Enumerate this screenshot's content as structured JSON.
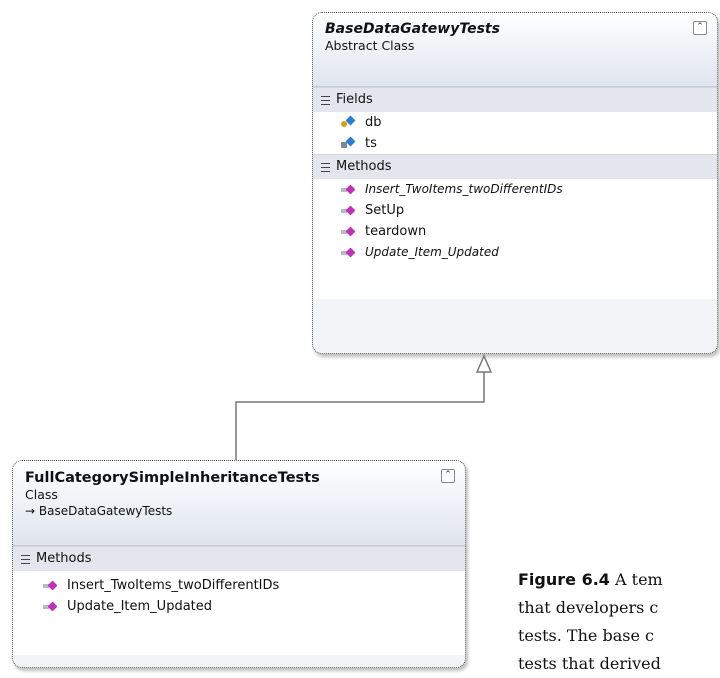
{
  "base_class": {
    "name": "BaseDataGatewyTests",
    "kind": "Abstract Class",
    "collapse_icon": "chevron-up-double",
    "sections": {
      "fields_label": "Fields",
      "fields": [
        "db",
        "ts"
      ],
      "methods_label": "Methods",
      "methods": [
        "Insert_TwoItems_twoDifferentIDs",
        "SetUp",
        "teardown",
        "Update_Item_Updated"
      ]
    }
  },
  "derived_class": {
    "name": "FullCategorySimpleInheritanceTests",
    "kind": "Class",
    "inherits": "→ BaseDataGatewyTests",
    "collapse_icon": "chevron-up-double",
    "methods_label": "Methods",
    "methods": [
      "Insert_TwoItems_twoDifferentIDs",
      "Update_Item_Updated"
    ]
  },
  "caption": {
    "label": "Figure 6.4",
    "line1": " A tem",
    "line2": "that developers c",
    "line3": "tests. The base c",
    "line4": "tests that derived"
  }
}
